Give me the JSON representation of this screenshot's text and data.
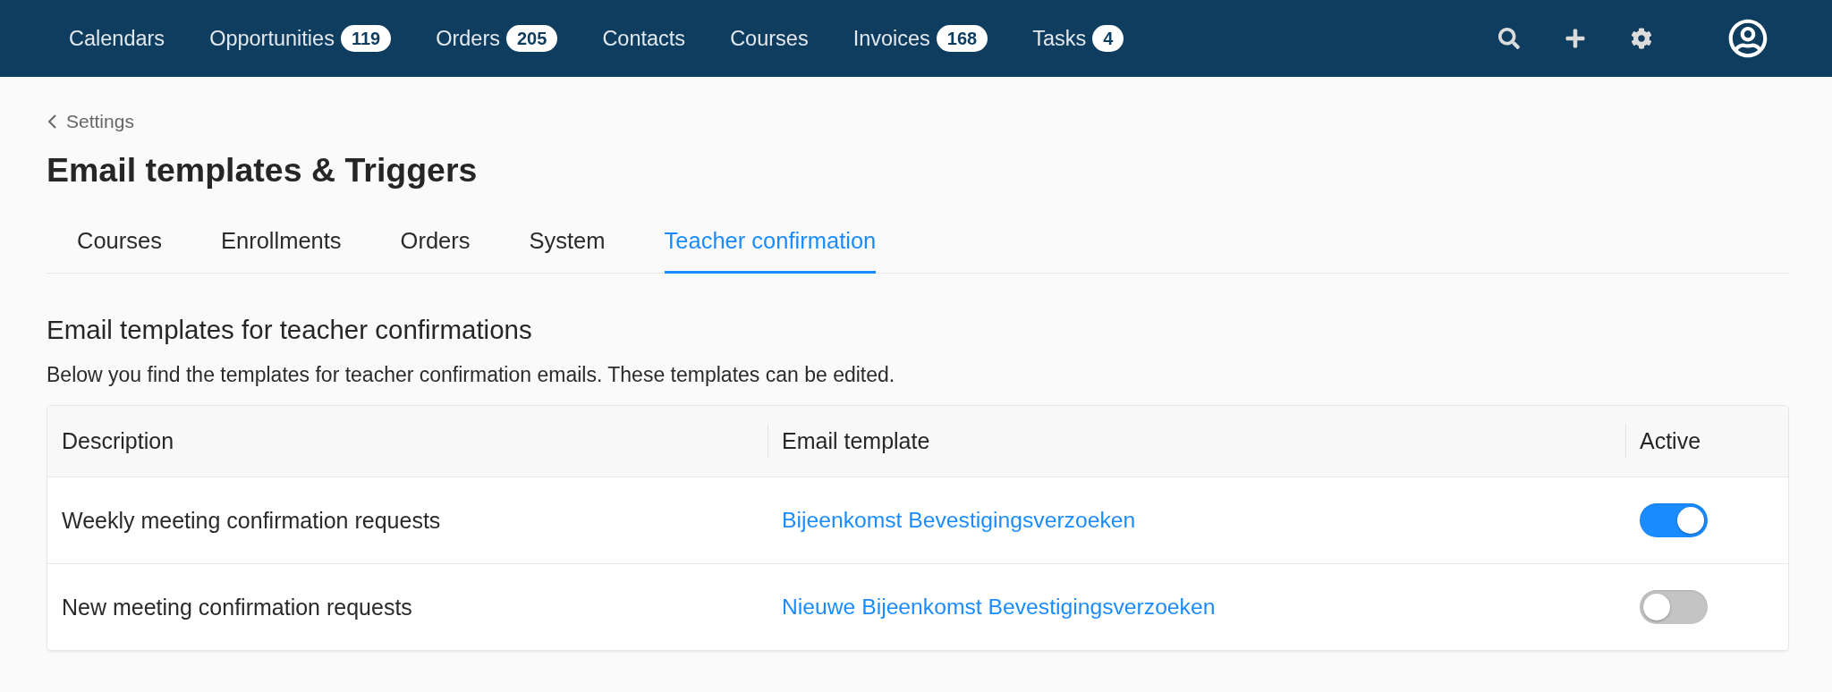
{
  "nav": {
    "items": [
      {
        "label": "Calendars"
      },
      {
        "label": "Opportunities",
        "badge": "119"
      },
      {
        "label": "Orders",
        "badge": "205"
      },
      {
        "label": "Contacts"
      },
      {
        "label": "Courses"
      },
      {
        "label": "Invoices",
        "badge": "168"
      },
      {
        "label": "Tasks",
        "badge": "4"
      }
    ]
  },
  "breadcrumb": {
    "label": "Settings"
  },
  "page_title": "Email templates & Triggers",
  "tabs": [
    {
      "label": "Courses",
      "selected": false
    },
    {
      "label": "Enrollments",
      "selected": false
    },
    {
      "label": "Orders",
      "selected": false
    },
    {
      "label": "System",
      "selected": false
    },
    {
      "label": "Teacher confirmation",
      "selected": true
    }
  ],
  "section": {
    "heading": "Email templates for teacher confirmations",
    "description": "Below you find the templates for teacher confirmation emails. These templates can be edited."
  },
  "table": {
    "columns": [
      "Description",
      "Email template",
      "Active"
    ],
    "rows": [
      {
        "description": "Weekly meeting confirmation requests",
        "template": "Bijeenkomst Bevestigingsverzoeken",
        "active": true
      },
      {
        "description": "New meeting confirmation requests",
        "template": "Nieuwe Bijeenkomst Bevestigingsverzoeken",
        "active": false
      }
    ]
  }
}
